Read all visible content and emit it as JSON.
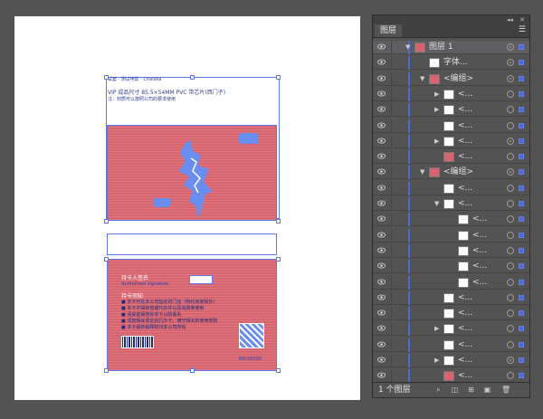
{
  "artboard": {
    "line1": "试套 · 测试电影 · Chelsea",
    "line2": "VIP 成品尺寸 85.5×54MM PVC 带芯片(西门子)",
    "line3": "注：材质可以按照公司的要求使用",
    "back_card": {
      "holder_label": "持卡人签名",
      "holder_sub": "Authorised signature",
      "notice_title": "持卡须知",
      "notice_lines": [
        "■ 本卡可在本公司指定的门店（特约商家除外）",
        "■ 本卡不得转借或代办并以及消费券使用",
        "■ 请妥善保管好本卡以防丢失",
        "■ 须按相关规定执行办卡，遵守相关的使用规则",
        "■ 本卡最终解释权归本公司所有"
      ],
      "card_no": "NO.00000"
    }
  },
  "panel": {
    "tab_label": "图层",
    "menu_icon": "panel-menu-icon",
    "collapse_icon": "double-chevron-icon",
    "close_icon": "close-icon",
    "rows": [
      {
        "label": "图层 1",
        "level": 0,
        "arrow": "down",
        "thumb": "pink",
        "target": "filled",
        "square": "filled",
        "top": true
      },
      {
        "label": "字体...",
        "level": 1,
        "arrow": "",
        "thumb": "white",
        "target": "filled",
        "square": "filled"
      },
      {
        "label": "<编组>",
        "level": 1,
        "arrow": "down",
        "thumb": "pink",
        "target": "filled",
        "square": "filled"
      },
      {
        "label": "<...",
        "level": 2,
        "arrow": "right",
        "thumb": "white",
        "target": "",
        "square": "filled"
      },
      {
        "label": "<...",
        "level": 2,
        "arrow": "right",
        "thumb": "white",
        "target": "",
        "square": "filled"
      },
      {
        "label": "<...",
        "level": 2,
        "arrow": "",
        "thumb": "white",
        "target": "",
        "square": "filled"
      },
      {
        "label": "<...",
        "level": 2,
        "arrow": "right",
        "thumb": "white",
        "target": "filled",
        "square": "filled"
      },
      {
        "label": "<...",
        "level": 2,
        "arrow": "",
        "thumb": "pink",
        "target": "",
        "square": "filled"
      },
      {
        "label": "<编组>",
        "level": 1,
        "arrow": "down",
        "thumb": "pink",
        "target": "filled",
        "square": "filled"
      },
      {
        "label": "<...",
        "level": 2,
        "arrow": "",
        "thumb": "white",
        "target": "",
        "square": "filled"
      },
      {
        "label": "<...",
        "level": 2,
        "arrow": "down",
        "thumb": "white",
        "target": "",
        "square": "filled"
      },
      {
        "label": "<...",
        "level": 3,
        "arrow": "",
        "thumb": "white",
        "target": "",
        "square": "filled"
      },
      {
        "label": "<...",
        "level": 3,
        "arrow": "",
        "thumb": "white",
        "target": "",
        "square": "filled"
      },
      {
        "label": "<...",
        "level": 3,
        "arrow": "",
        "thumb": "white",
        "target": "",
        "square": "filled"
      },
      {
        "label": "<...",
        "level": 3,
        "arrow": "",
        "thumb": "white",
        "target": "",
        "square": "filled"
      },
      {
        "label": "<...",
        "level": 3,
        "arrow": "",
        "thumb": "white",
        "target": "",
        "square": "filled"
      },
      {
        "label": "<...",
        "level": 2,
        "arrow": "",
        "thumb": "white",
        "target": "",
        "square": "filled"
      },
      {
        "label": "<...",
        "level": 2,
        "arrow": "",
        "thumb": "white",
        "target": "",
        "square": "filled"
      },
      {
        "label": "<...",
        "level": 2,
        "arrow": "right",
        "thumb": "white",
        "target": "",
        "square": "filled"
      },
      {
        "label": "<...",
        "level": 2,
        "arrow": "",
        "thumb": "white",
        "target": "",
        "square": "filled"
      },
      {
        "label": "<...",
        "level": 2,
        "arrow": "right",
        "thumb": "white",
        "target": "filled",
        "square": "filled"
      },
      {
        "label": "<...",
        "level": 2,
        "arrow": "",
        "thumb": "pink",
        "target": "",
        "square": "filled"
      }
    ],
    "footer": {
      "layer_count": "1 个图层",
      "icons": [
        "locate-object-icon",
        "make-clipping-mask-icon",
        "new-sublayer-icon",
        "new-layer-icon",
        "delete-icon"
      ]
    }
  },
  "colors": {
    "card_fill": "#d7646f",
    "selection_blue": "#5b77e8",
    "canvas_bg": "#535353"
  }
}
